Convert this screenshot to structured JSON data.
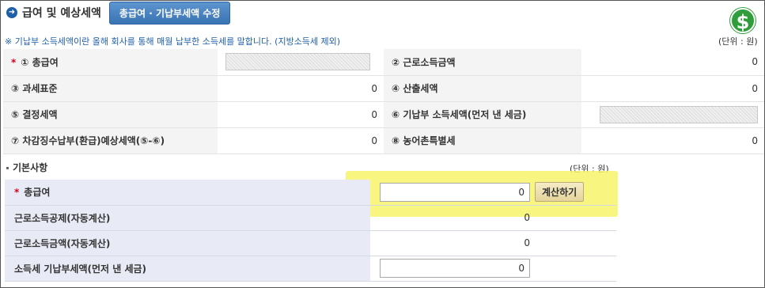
{
  "header": {
    "title": "급여 및 예상세액",
    "edit_button": "총급여 · 기납부세액 수정",
    "dollar_symbol": "$"
  },
  "note": "※ 기납부 소득세액이란 올해 회사를 통해 매월 납부한 소득세를 말합니다. (지방소득세 제외)",
  "unit_top": "(단위 : 원)",
  "summary": {
    "rows": [
      {
        "req": "*",
        "l1": "① 총급여",
        "v1": "",
        "l2": "② 근로소득금액",
        "v2": "0"
      },
      {
        "l1": "③ 과세표준",
        "v1": "0",
        "l2": "④ 산출세액",
        "v2": "0"
      },
      {
        "l1": "⑤ 결정세액",
        "v1": "0",
        "l2": "⑥ 기납부 소득세액(먼저 낸 세금)",
        "v2": ""
      },
      {
        "l1": "⑦ 차감징수납부(환급)예상세액(⑤-⑥)",
        "v1": "0",
        "l2": "⑧ 농어촌특별세",
        "v2": "0"
      }
    ]
  },
  "basic": {
    "title": "기본사항",
    "unit": "(단위 : 원)",
    "rows": [
      {
        "req": "*",
        "label": "총급여",
        "value": "0",
        "button": "계산하기"
      },
      {
        "label": "근로소득공제(자동계산)",
        "value": "0"
      },
      {
        "label": "근로소득금액(자동계산)",
        "value": "0"
      },
      {
        "label": "소득세 기납부세액(먼저 낸 세금)",
        "value": "0"
      }
    ]
  },
  "colors": {
    "accent_blue": "#3a73b3",
    "required_red": "#d0021b",
    "highlight_yellow": "#f7f46a",
    "dollar_green": "#2f9e3a"
  }
}
